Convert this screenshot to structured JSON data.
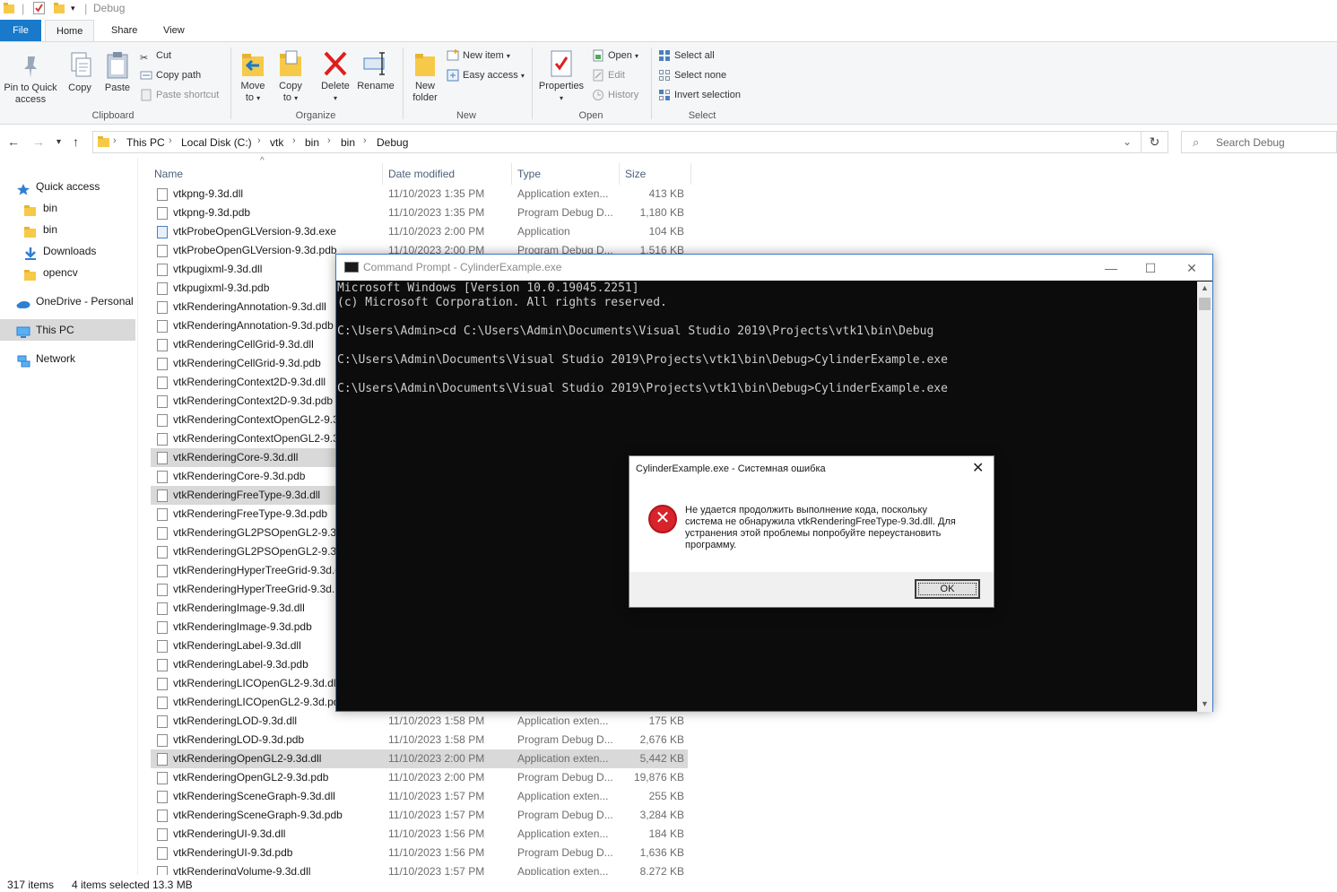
{
  "window": {
    "title": "Debug"
  },
  "menu": {
    "file": "File",
    "home": "Home",
    "share": "Share",
    "view": "View"
  },
  "ribbon": {
    "clipboard": {
      "group": "Clipboard",
      "pin_line1": "Pin to Quick",
      "pin_line2": "access",
      "copy": "Copy",
      "paste": "Paste",
      "cut": "Cut",
      "copy_path": "Copy path",
      "paste_shortcut": "Paste shortcut"
    },
    "organize": {
      "group": "Organize",
      "move_line1": "Move",
      "move_line2": "to",
      "copy_line1": "Copy",
      "copy_line2": "to",
      "delete": "Delete",
      "rename": "Rename"
    },
    "new": {
      "group": "New",
      "new_folder_line1": "New",
      "new_folder_line2": "folder",
      "new_item": "New item",
      "easy_access": "Easy access"
    },
    "open": {
      "group": "Open",
      "properties": "Properties",
      "open": "Open",
      "edit": "Edit",
      "history": "History"
    },
    "select": {
      "group": "Select",
      "select_all": "Select all",
      "select_none": "Select none",
      "invert": "Invert selection"
    }
  },
  "address": {
    "crumbs": [
      "This PC",
      "Local Disk (C:)",
      "vtk",
      "bin",
      "bin",
      "Debug"
    ],
    "search_placeholder": "Search Debug"
  },
  "nav": {
    "items": [
      {
        "label": "Quick access",
        "icon": "star-icon"
      },
      {
        "label": "bin",
        "icon": "folder-icon"
      },
      {
        "label": "bin",
        "icon": "folder-icon"
      },
      {
        "label": "Downloads",
        "icon": "download-icon"
      },
      {
        "label": "opencv",
        "icon": "folder-icon"
      },
      {
        "label": "OneDrive - Personal",
        "icon": "cloud-icon"
      },
      {
        "label": "This PC",
        "icon": "computer-icon"
      },
      {
        "label": "Network",
        "icon": "network-icon"
      }
    ]
  },
  "columns": {
    "name": "Name",
    "date": "Date modified",
    "type": "Type",
    "size": "Size"
  },
  "files": [
    {
      "name": "vtkpng-9.3d.dll",
      "date": "11/10/2023 1:35 PM",
      "type": "Application exten...",
      "size": "413 KB",
      "kind": "dll",
      "selected": false
    },
    {
      "name": "vtkpng-9.3d.pdb",
      "date": "11/10/2023 1:35 PM",
      "type": "Program Debug D...",
      "size": "1,180 KB",
      "kind": "pdb",
      "selected": false
    },
    {
      "name": "vtkProbeOpenGLVersion-9.3d.exe",
      "date": "11/10/2023 2:00 PM",
      "type": "Application",
      "size": "104 KB",
      "kind": "exe",
      "selected": false
    },
    {
      "name": "vtkProbeOpenGLVersion-9.3d.pdb",
      "date": "11/10/2023 2:00 PM",
      "type": "Program Debug D...",
      "size": "1,516 KB",
      "kind": "pdb",
      "selected": false
    },
    {
      "name": "vtkpugixml-9.3d.dll",
      "date": "",
      "type": "",
      "size": "",
      "kind": "dll",
      "selected": false
    },
    {
      "name": "vtkpugixml-9.3d.pdb",
      "date": "",
      "type": "",
      "size": "",
      "kind": "pdb",
      "selected": false
    },
    {
      "name": "vtkRenderingAnnotation-9.3d.dll",
      "date": "",
      "type": "",
      "size": "",
      "kind": "dll",
      "selected": false
    },
    {
      "name": "vtkRenderingAnnotation-9.3d.pdb",
      "date": "",
      "type": "",
      "size": "",
      "kind": "pdb",
      "selected": false
    },
    {
      "name": "vtkRenderingCellGrid-9.3d.dll",
      "date": "",
      "type": "",
      "size": "",
      "kind": "dll",
      "selected": false
    },
    {
      "name": "vtkRenderingCellGrid-9.3d.pdb",
      "date": "",
      "type": "",
      "size": "",
      "kind": "pdb",
      "selected": false
    },
    {
      "name": "vtkRenderingContext2D-9.3d.dll",
      "date": "",
      "type": "",
      "size": "",
      "kind": "dll",
      "selected": false
    },
    {
      "name": "vtkRenderingContext2D-9.3d.pdb",
      "date": "",
      "type": "",
      "size": "",
      "kind": "pdb",
      "selected": false
    },
    {
      "name": "vtkRenderingContextOpenGL2-9.3",
      "date": "",
      "type": "",
      "size": "",
      "kind": "dll",
      "selected": false
    },
    {
      "name": "vtkRenderingContextOpenGL2-9.3",
      "date": "",
      "type": "",
      "size": "",
      "kind": "pdb",
      "selected": false
    },
    {
      "name": "vtkRenderingCore-9.3d.dll",
      "date": "",
      "type": "",
      "size": "",
      "kind": "dll",
      "selected": true
    },
    {
      "name": "vtkRenderingCore-9.3d.pdb",
      "date": "",
      "type": "",
      "size": "",
      "kind": "pdb",
      "selected": false
    },
    {
      "name": "vtkRenderingFreeType-9.3d.dll",
      "date": "",
      "type": "",
      "size": "",
      "kind": "dll",
      "selected": true
    },
    {
      "name": "vtkRenderingFreeType-9.3d.pdb",
      "date": "",
      "type": "",
      "size": "",
      "kind": "pdb",
      "selected": false
    },
    {
      "name": "vtkRenderingGL2PSOpenGL2-9.3d.",
      "date": "",
      "type": "",
      "size": "",
      "kind": "dll",
      "selected": false
    },
    {
      "name": "vtkRenderingGL2PSOpenGL2-9.3d.",
      "date": "",
      "type": "",
      "size": "",
      "kind": "pdb",
      "selected": false
    },
    {
      "name": "vtkRenderingHyperTreeGrid-9.3d.d",
      "date": "",
      "type": "",
      "size": "",
      "kind": "dll",
      "selected": false
    },
    {
      "name": "vtkRenderingHyperTreeGrid-9.3d.p",
      "date": "",
      "type": "",
      "size": "",
      "kind": "pdb",
      "selected": false
    },
    {
      "name": "vtkRenderingImage-9.3d.dll",
      "date": "",
      "type": "",
      "size": "",
      "kind": "dll",
      "selected": false
    },
    {
      "name": "vtkRenderingImage-9.3d.pdb",
      "date": "",
      "type": "",
      "size": "",
      "kind": "pdb",
      "selected": false
    },
    {
      "name": "vtkRenderingLabel-9.3d.dll",
      "date": "",
      "type": "",
      "size": "",
      "kind": "dll",
      "selected": false
    },
    {
      "name": "vtkRenderingLabel-9.3d.pdb",
      "date": "",
      "type": "",
      "size": "",
      "kind": "pdb",
      "selected": false
    },
    {
      "name": "vtkRenderingLICOpenGL2-9.3d.dll",
      "date": "",
      "type": "",
      "size": "",
      "kind": "dll",
      "selected": false
    },
    {
      "name": "vtkRenderingLICOpenGL2-9.3d.pdl",
      "date": "",
      "type": "",
      "size": "",
      "kind": "pdb",
      "selected": false
    },
    {
      "name": "vtkRenderingLOD-9.3d.dll",
      "date": "11/10/2023 1:58 PM",
      "type": "Application exten...",
      "size": "175 KB",
      "kind": "dll",
      "selected": false
    },
    {
      "name": "vtkRenderingLOD-9.3d.pdb",
      "date": "11/10/2023 1:58 PM",
      "type": "Program Debug D...",
      "size": "2,676 KB",
      "kind": "pdb",
      "selected": false
    },
    {
      "name": "vtkRenderingOpenGL2-9.3d.dll",
      "date": "11/10/2023 2:00 PM",
      "type": "Application exten...",
      "size": "5,442 KB",
      "kind": "dll",
      "selected": true
    },
    {
      "name": "vtkRenderingOpenGL2-9.3d.pdb",
      "date": "11/10/2023 2:00 PM",
      "type": "Program Debug D...",
      "size": "19,876 KB",
      "kind": "pdb",
      "selected": false
    },
    {
      "name": "vtkRenderingSceneGraph-9.3d.dll",
      "date": "11/10/2023 1:57 PM",
      "type": "Application exten...",
      "size": "255 KB",
      "kind": "dll",
      "selected": false
    },
    {
      "name": "vtkRenderingSceneGraph-9.3d.pdb",
      "date": "11/10/2023 1:57 PM",
      "type": "Program Debug D...",
      "size": "3,284 KB",
      "kind": "pdb",
      "selected": false
    },
    {
      "name": "vtkRenderingUI-9.3d.dll",
      "date": "11/10/2023 1:56 PM",
      "type": "Application exten...",
      "size": "184 KB",
      "kind": "dll",
      "selected": false
    },
    {
      "name": "vtkRenderingUI-9.3d.pdb",
      "date": "11/10/2023 1:56 PM",
      "type": "Program Debug D...",
      "size": "1,636 KB",
      "kind": "pdb",
      "selected": false
    },
    {
      "name": "vtkRenderingVolume-9.3d.dll",
      "date": "11/10/2023 1:57 PM",
      "type": "Application exten...",
      "size": "8,272 KB",
      "kind": "dll",
      "selected": false
    }
  ],
  "status": {
    "count": "317 items",
    "selected": "4 items selected",
    "size": "13.3 MB"
  },
  "cmd": {
    "title": "Command Prompt - CylinderExample.exe",
    "lines": [
      "Microsoft Windows [Version 10.0.19045.2251]",
      "(c) Microsoft Corporation. All rights reserved.",
      "",
      "C:\\Users\\Admin>cd C:\\Users\\Admin\\Documents\\Visual Studio 2019\\Projects\\vtk1\\bin\\Debug",
      "",
      "C:\\Users\\Admin\\Documents\\Visual Studio 2019\\Projects\\vtk1\\bin\\Debug>CylinderExample.exe",
      "",
      "C:\\Users\\Admin\\Documents\\Visual Studio 2019\\Projects\\vtk1\\bin\\Debug>CylinderExample.exe"
    ]
  },
  "dialog": {
    "title": "CylinderExample.exe - Системная ошибка",
    "message_lines": [
      "Не удается продолжить выполнение кода, поскольку",
      "система не обнаружила vtkRenderingFreeType-9.3d.dll. Для",
      "устранения этой проблемы попробуйте переустановить",
      "программу."
    ],
    "ok": "OK"
  },
  "colors": {
    "accent": "#1979ca",
    "selection": "#d9d9d9",
    "console_bg": "#0c0c0c",
    "console_fg": "#cccccc",
    "error_red": "#d8232a"
  }
}
